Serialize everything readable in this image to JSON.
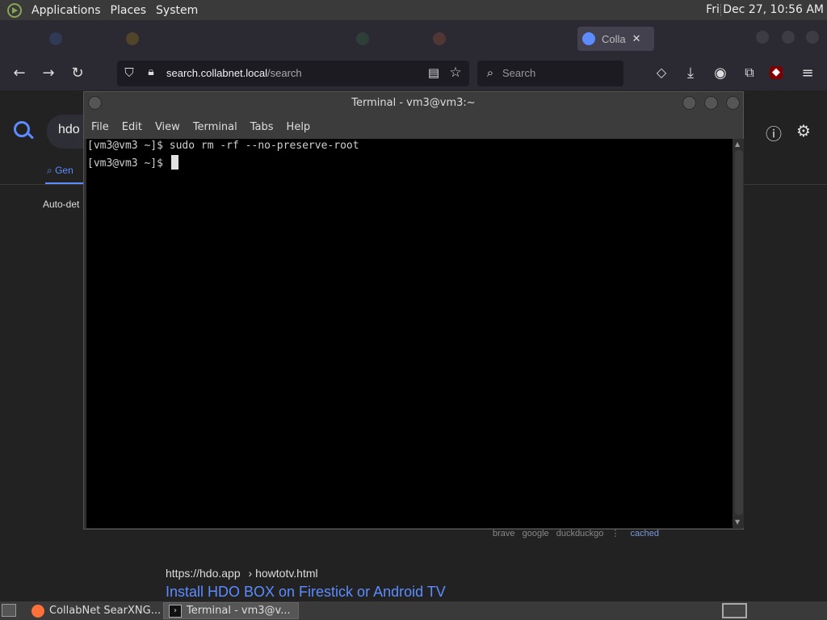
{
  "top_panel": {
    "menus": [
      "Applications",
      "Places",
      "System"
    ],
    "clock": "Fri Dec 27, 10:56 AM"
  },
  "browser": {
    "active_tab": {
      "label": "Colla",
      "close": "✕"
    },
    "url": {
      "host": "search.collabnet.local",
      "path": "/search"
    },
    "search_placeholder": "Search"
  },
  "page": {
    "query": "hdo",
    "tab_general": "Gen",
    "auto_detect": "Auto-det",
    "engines": [
      "brave",
      "google",
      "duckduckgo"
    ],
    "engines_sep": "⋮",
    "cached": "cached",
    "result_url_host": "https://hdo.app",
    "result_url_path": "› howtotv.html",
    "result_title": "Install HDO BOX on Firestick or Android TV"
  },
  "terminal": {
    "title": "Terminal - vm3@vm3:~",
    "menu": [
      "File",
      "Edit",
      "View",
      "Terminal",
      "Tabs",
      "Help"
    ],
    "lines": [
      "[vm3@vm3 ~]$ sudo rm -rf --no-preserve-root",
      "[vm3@vm3 ~]$ "
    ]
  },
  "taskbar": {
    "items": [
      {
        "label": "CollabNet SearXNG..."
      },
      {
        "label": "Terminal - vm3@v..."
      }
    ]
  },
  "colors": {
    "accent": "#5c8cff",
    "panel": "#3a3a3a",
    "terminal_bg": "#000000"
  }
}
